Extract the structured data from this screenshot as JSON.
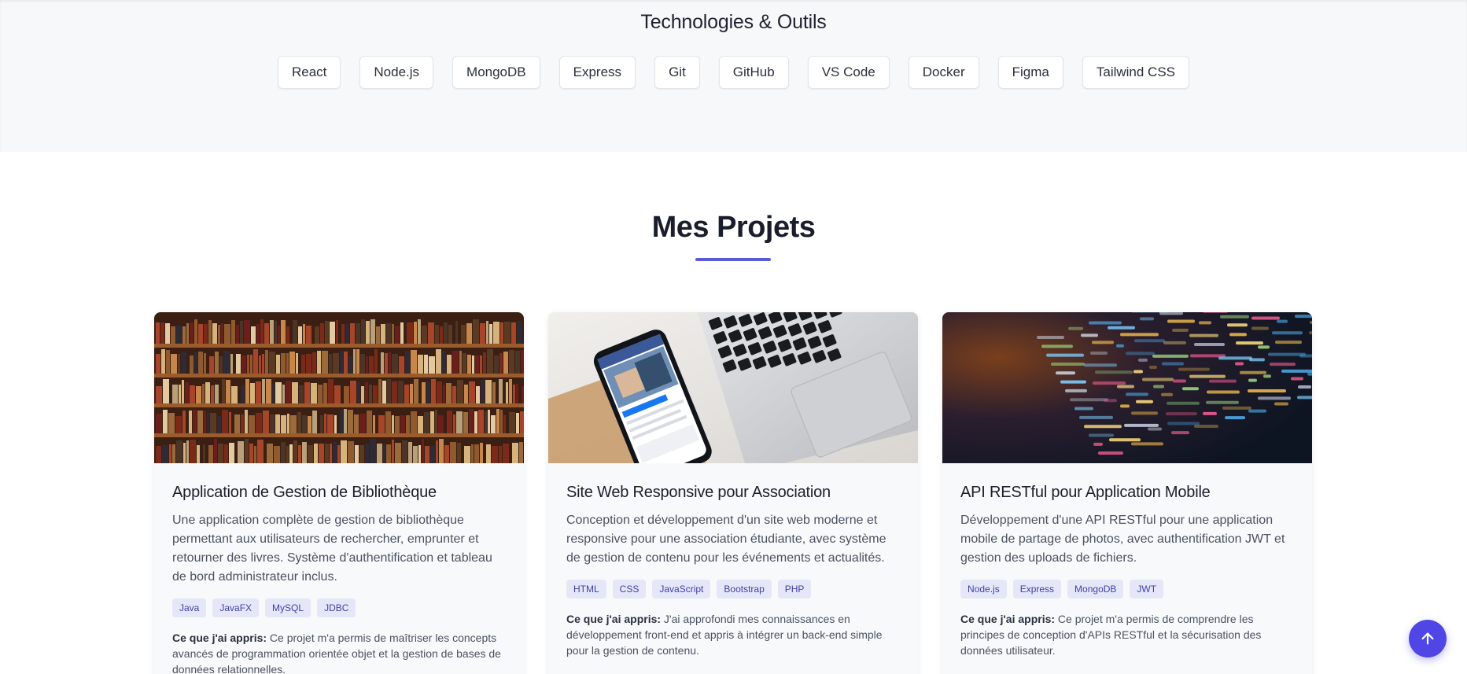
{
  "tech_section": {
    "title": "Technologies & Outils",
    "items": [
      "React",
      "Node.js",
      "MongoDB",
      "Express",
      "Git",
      "GitHub",
      "VS Code",
      "Docker",
      "Figma",
      "Tailwind CSS"
    ]
  },
  "projects": {
    "title": "Mes Projets",
    "accent_color": "#5b5bd6",
    "cards": [
      {
        "image_subject": "bookshelf-library",
        "title": "Application de Gestion de Bibliothèque",
        "description": "Une application complète de gestion de bibliothèque permettant aux utilisateurs de rechercher, emprunter et retourner des livres. Système d'authentification et tableau de bord administrateur inclus.",
        "tags": [
          "Java",
          "JavaFX",
          "MySQL",
          "JDBC"
        ],
        "learned_label": "Ce que j'ai appris:",
        "learned_text": " Ce projet m'a permis de maîtriser les concepts avancés de programmation orientée objet et la gestion de bases de données relationnelles."
      },
      {
        "image_subject": "phone-and-laptop",
        "title": "Site Web Responsive pour Association",
        "description": "Conception et développement d'un site web moderne et responsive pour une association étudiante, avec système de gestion de contenu pour les événements et actualités.",
        "tags": [
          "HTML",
          "CSS",
          "JavaScript",
          "Bootstrap",
          "PHP"
        ],
        "learned_label": "Ce que j'ai appris:",
        "learned_text": " J'ai approfondi mes connaissances en développement front-end et appris à intégrer un back-end simple pour la gestion de contenu."
      },
      {
        "image_subject": "code-on-screen",
        "title": "API RESTful pour Application Mobile",
        "description": "Développement d'une API RESTful pour une application mobile de partage de photos, avec authentification JWT et gestion des uploads de fichiers.",
        "tags": [
          "Node.js",
          "Express",
          "MongoDB",
          "JWT"
        ],
        "learned_label": "Ce que j'ai appris:",
        "learned_text": " Ce projet m'a permis de comprendre les principes de conception d'APIs RESTful et la sécurisation des données utilisateur."
      }
    ]
  },
  "scroll_top_button": {
    "icon": "arrow-up-icon",
    "color": "#4f46e5"
  }
}
